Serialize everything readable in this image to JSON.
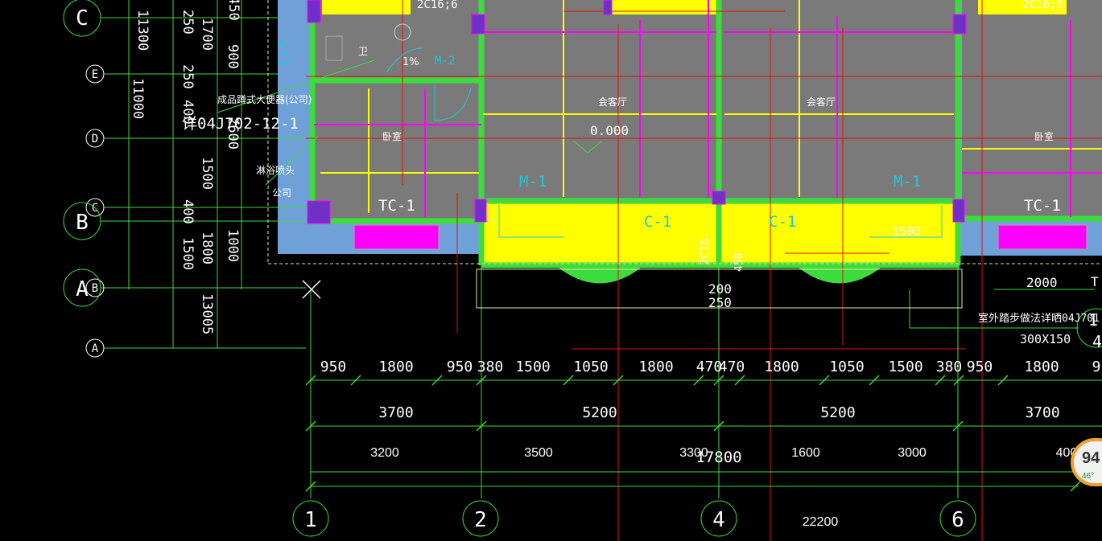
{
  "grid_axes_horizontal": [
    "C",
    "E",
    "D",
    "C",
    "B",
    "B",
    "A",
    "A"
  ],
  "grid_axes_vertical": [
    "1",
    "2",
    "4",
    "6"
  ],
  "left_dims": [
    "11300",
    "11000",
    "250",
    "1700",
    "250",
    "400",
    "2600",
    "1500",
    "400",
    "1500",
    "1800",
    "1000",
    "13005",
    "450",
    "900"
  ],
  "room_labels": [
    "卫",
    "卧室",
    "会客厅",
    "会客厅",
    "卧室"
  ],
  "annotations": [
    "成品蹲式大便器(公司)",
    "详04J702-12-1",
    "淋浴喷头",
    "公司",
    "1%",
    "C-2",
    "M-2"
  ],
  "window_labels": [
    "TC-1",
    "TC-1",
    "C-1",
    "C-1",
    "M-1",
    "M-1"
  ],
  "rebar_labels": [
    "2C16;6",
    "2C16;6",
    "2C16"
  ],
  "elevation": "0.000",
  "front_dims": [
    "1500",
    "250",
    "200",
    "450"
  ],
  "side_notes": [
    "2000",
    "室外踏步做法详晒04J701",
    "300X150",
    "1",
    "4",
    "T"
  ],
  "dim_row1": [
    "950",
    "1800",
    "950",
    "380",
    "1500",
    "1050",
    "1800",
    "470",
    "470",
    "1800",
    "1050",
    "1500",
    "380",
    "950",
    "1800",
    "9"
  ],
  "dim_row2": [
    "3700",
    "5200",
    "5200",
    "3700"
  ],
  "dim_row3": [
    "3200",
    "3500",
    "3300",
    "1600",
    "3000",
    "400"
  ],
  "total_dim": "17800",
  "bottom_dim": "22200",
  "widget": {
    "value": "94",
    "sub": "46°"
  },
  "colors": {
    "wall": "#3cdc3c",
    "fill_yellow": "#ffff00",
    "magenta": "#ff00ff",
    "red": "#e01010",
    "blue_slab": "#6fa0d8",
    "room_gray": "#7a7a7a"
  }
}
